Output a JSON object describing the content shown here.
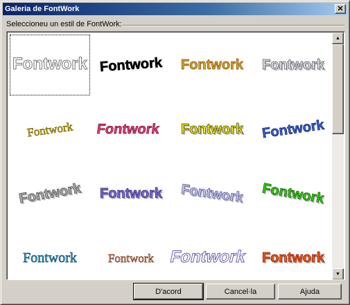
{
  "window": {
    "title": "Galeria de FontWork",
    "close_label": "✕"
  },
  "group": {
    "label": "Seleccioneu un estil de FontWork:"
  },
  "gallery": {
    "items": [
      {
        "text": "Fontwork",
        "style": "outline",
        "fill": "#ffffff",
        "stroke": "#777777"
      },
      {
        "text": "Fontwork",
        "style": "arc-up",
        "fill": "#000000",
        "stroke": "#000000"
      },
      {
        "text": "Fontwork",
        "style": "gradient",
        "fill": "#d9a12a",
        "stroke": "#7a4b00"
      },
      {
        "text": "Fontwork",
        "style": "chrome",
        "fill": "#e8e8f0",
        "stroke": "#4a4a55"
      },
      {
        "text": "Fontwork",
        "style": "slant-serif",
        "fill": "#d6d000",
        "stroke": "#706000"
      },
      {
        "text": "Fontwork",
        "style": "perspective",
        "fill": "#e0407a",
        "stroke": "#6a0020"
      },
      {
        "text": "Fontwork",
        "style": "yellow-block",
        "fill": "#f4f000",
        "stroke": "#333300"
      },
      {
        "text": "Fontwork",
        "style": "blue-slant",
        "fill": "#3a5fd0",
        "stroke": "#0a1a60"
      },
      {
        "text": "Fontwork",
        "style": "grey-3d",
        "fill": "#b0b0b0",
        "stroke": "#404040"
      },
      {
        "text": "Fontwork",
        "style": "purple",
        "fill": "#7a6ad8",
        "stroke": "#2a1a70"
      },
      {
        "text": "Fontwork",
        "style": "silver-wave",
        "fill": "#c8c8ee",
        "stroke": "#4a4a90"
      },
      {
        "text": "Fontwork",
        "style": "green-arc",
        "fill": "#30d000",
        "stroke": "#0a5000"
      },
      {
        "text": "Fontwork",
        "style": "teal",
        "fill": "#3aa8c8",
        "stroke": "#0a4a6a"
      },
      {
        "text": "Fontwork",
        "style": "brown-arc",
        "fill": "#e8b090",
        "stroke": "#7a3a1a"
      },
      {
        "text": "Fontwork",
        "style": "purple-outline",
        "fill": "#ffffff",
        "stroke": "#6a5aa8"
      },
      {
        "text": "Fontwork",
        "style": "fire",
        "fill": "#f06000",
        "stroke": "#8a0000"
      }
    ]
  },
  "buttons": {
    "ok": "D'acord",
    "cancel": "Cancel·la",
    "help": "Ajuda"
  },
  "scrollbar": {
    "up_icon": "▲",
    "down_icon": "▼"
  }
}
